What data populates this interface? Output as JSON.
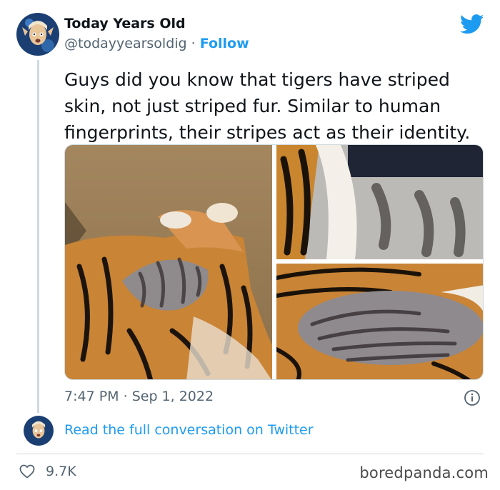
{
  "tweet": {
    "author_name": "Today Years Old",
    "handle": "@todayyearsoldig",
    "separator": " · ",
    "follow_label": "Follow",
    "text": "Guys did you know that tigers have striped skin, not just striped fur. Similar to human fingerprints, their stripes act as their identity.",
    "time": "7:47 PM",
    "date": "Sep 1, 2022",
    "read_link": "Read the full conversation on Twitter",
    "likes": "9.7K"
  },
  "icons": {
    "logo": "twitter-bird-icon",
    "info": "info-icon",
    "like": "heart-icon"
  },
  "watermark": "boredpanda.com",
  "colors": {
    "accent": "#1d9bf0",
    "text": "#0f1419",
    "secondary": "#536471",
    "border": "#cfd9de"
  }
}
